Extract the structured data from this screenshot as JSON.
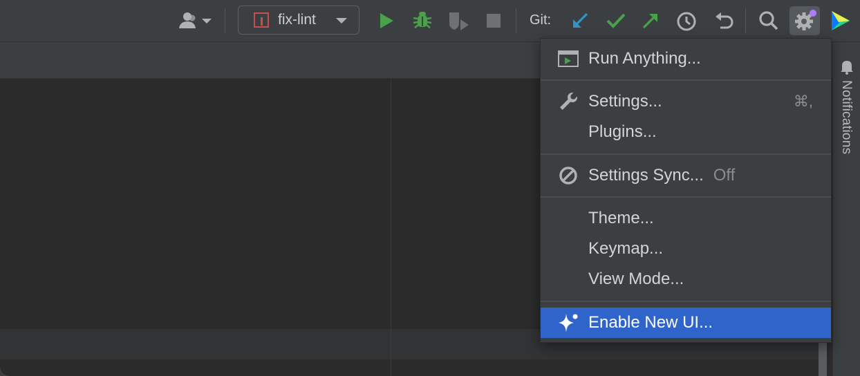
{
  "toolbar": {
    "branch": "fix-lint",
    "git_label": "Git:",
    "icons": [
      "user-icon",
      "run-icon",
      "debug-icon",
      "coverage-icon",
      "stop-icon",
      "update-project-icon",
      "commit-icon",
      "push-icon",
      "history-icon",
      "rollback-icon",
      "search-icon",
      "settings-gear-icon",
      "jetbrains-logo-icon"
    ],
    "colors": {
      "run": "#49a24a",
      "debug": "#49a24a",
      "git_update": "#3592c4",
      "git_commit": "#49a24a",
      "git_push": "#49a24a",
      "notification_dot": "#b07cff"
    }
  },
  "menu": {
    "items": [
      {
        "label": "Run Anything...",
        "icon": "run-anything-icon"
      },
      {
        "label": "Settings...",
        "icon": "wrench-icon",
        "shortcut": "⌘,"
      },
      {
        "label": "Plugins..."
      },
      {
        "label": "Settings Sync...",
        "icon": "sync-off-icon",
        "status": "Off"
      },
      {
        "label": "Theme..."
      },
      {
        "label": "Keymap..."
      },
      {
        "label": "View Mode..."
      },
      {
        "label": "Enable New UI...",
        "icon": "sparkle-icon",
        "selected": true
      }
    ],
    "selected_color": "#2f65ca"
  },
  "side_panel": {
    "notifications_label": "Notifications"
  }
}
